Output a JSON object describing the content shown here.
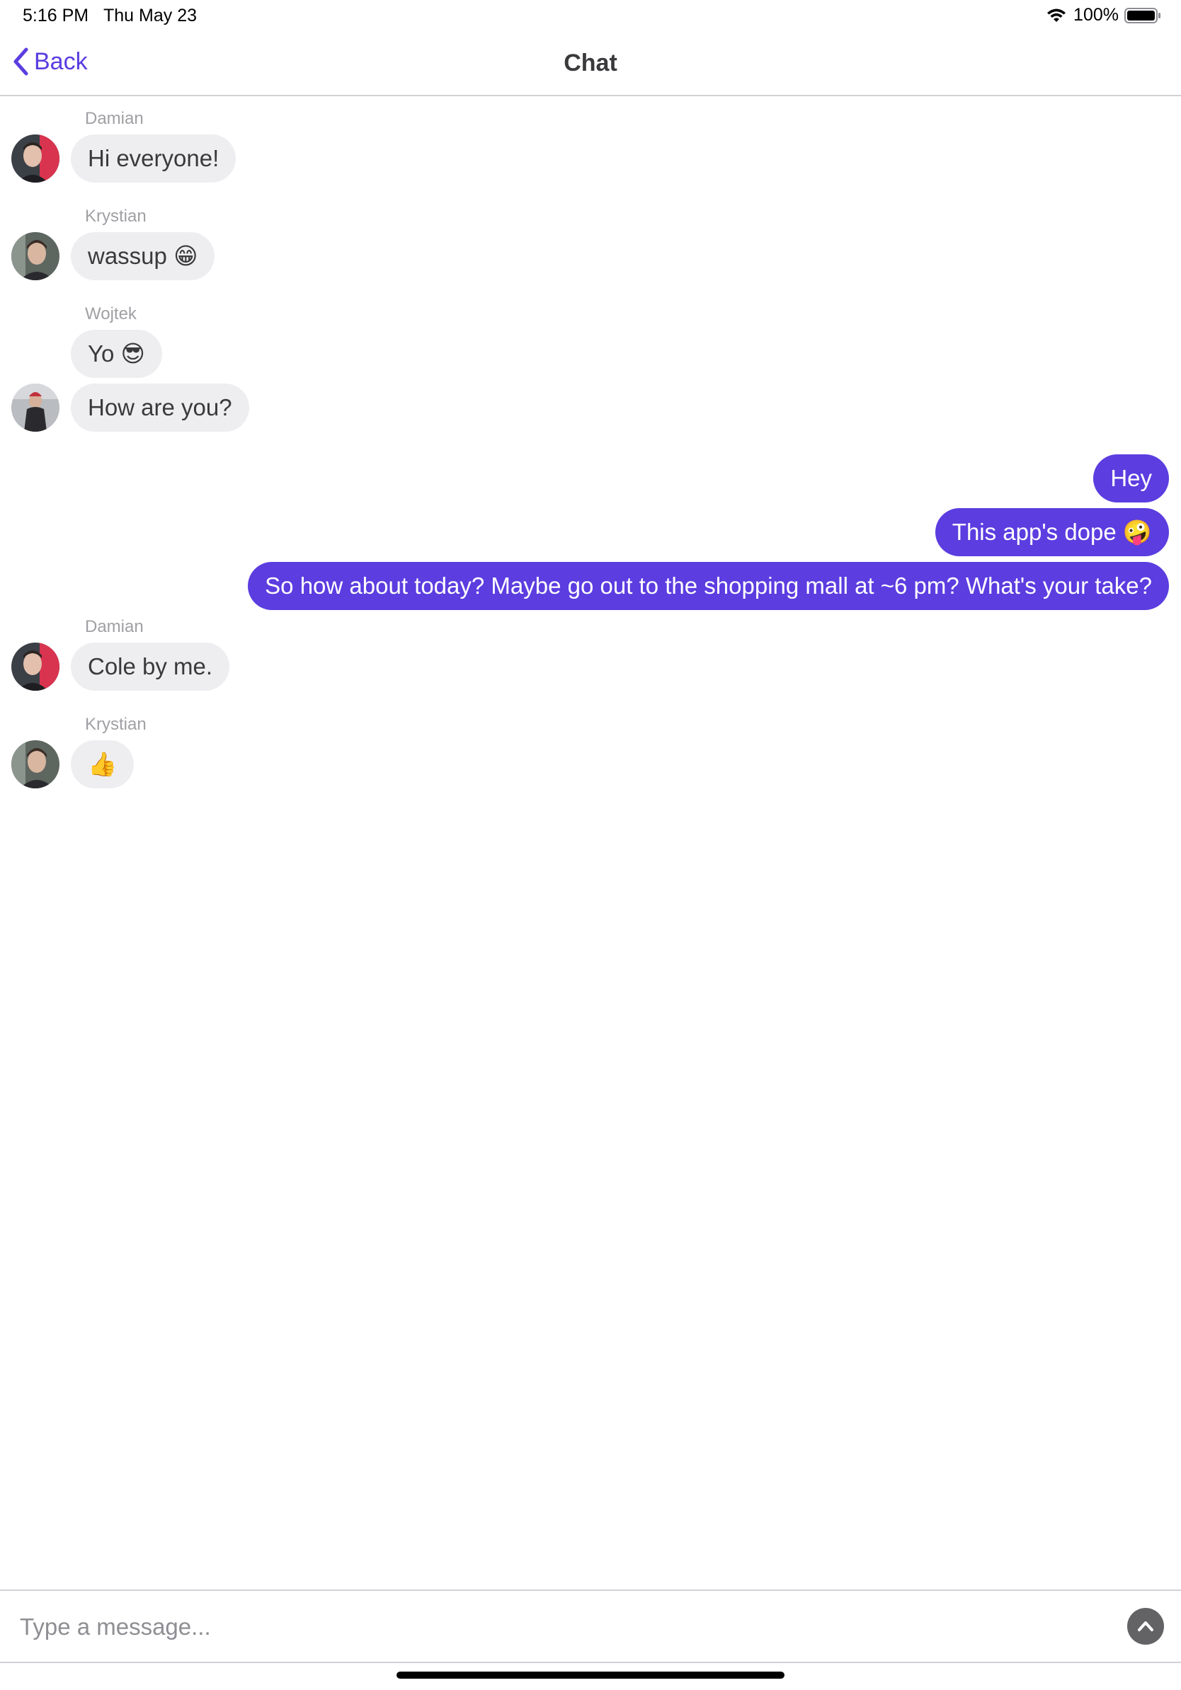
{
  "status_bar": {
    "time": "5:16 PM",
    "date": "Thu May 23",
    "battery": "100%",
    "icons": [
      "wifi-icon",
      "battery-icon"
    ]
  },
  "nav": {
    "back_label": "Back",
    "title": "Chat",
    "accent_color": "#5b3de0"
  },
  "messages": [
    {
      "sender": "Damian",
      "text": "Hi everyone!",
      "emoji": "",
      "outgoing": false
    },
    {
      "sender": "Krystian",
      "text": "wassup",
      "emoji": "😁",
      "outgoing": false
    },
    {
      "sender": "Wojtek",
      "text": "Yo",
      "emoji": "😎",
      "outgoing": false
    },
    {
      "sender": "Wojtek",
      "text": "How are you?",
      "emoji": "",
      "outgoing": false
    },
    {
      "sender": "",
      "text": "Hey",
      "emoji": "",
      "outgoing": true
    },
    {
      "sender": "",
      "text": "This app's dope",
      "emoji": "🤪",
      "outgoing": true
    },
    {
      "sender": "",
      "text": "So how about today? Maybe go out to the shopping mall at ~6 pm? What's your take?",
      "emoji": "",
      "outgoing": true
    },
    {
      "sender": "Damian",
      "text": "Cole by me.",
      "emoji": "",
      "outgoing": false
    },
    {
      "sender": "Krystian",
      "text": "",
      "emoji": "👍",
      "outgoing": false
    }
  ],
  "composer": {
    "placeholder": "Type a message...",
    "send_icon": "chevron-up-icon"
  },
  "colors": {
    "incoming_bubble": "#eeeef1",
    "outgoing_bubble": "#5b3de0",
    "sender_name": "#a0a0a5"
  }
}
